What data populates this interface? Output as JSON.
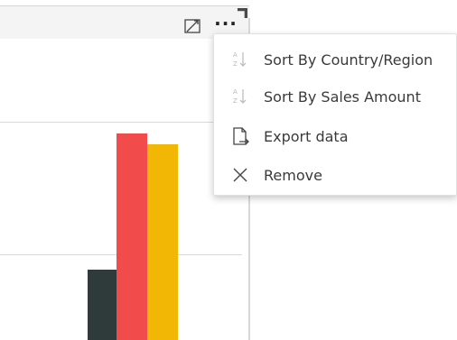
{
  "context_menu": {
    "items": [
      {
        "label": "Sort By Country/Region",
        "icon": "sort-icon"
      },
      {
        "label": "Sort By Sales Amount",
        "icon": "sort-icon"
      },
      {
        "label": "Export data",
        "icon": "export-data-icon"
      },
      {
        "label": "Remove",
        "icon": "close-icon"
      }
    ]
  },
  "visual_header": {
    "icons": [
      "focus-mode-icon",
      "more-options-icon"
    ]
  },
  "colors": {
    "series_dark": "#2f3b3a",
    "series_red": "#f24b4b",
    "series_yellow": "#f2b705"
  }
}
